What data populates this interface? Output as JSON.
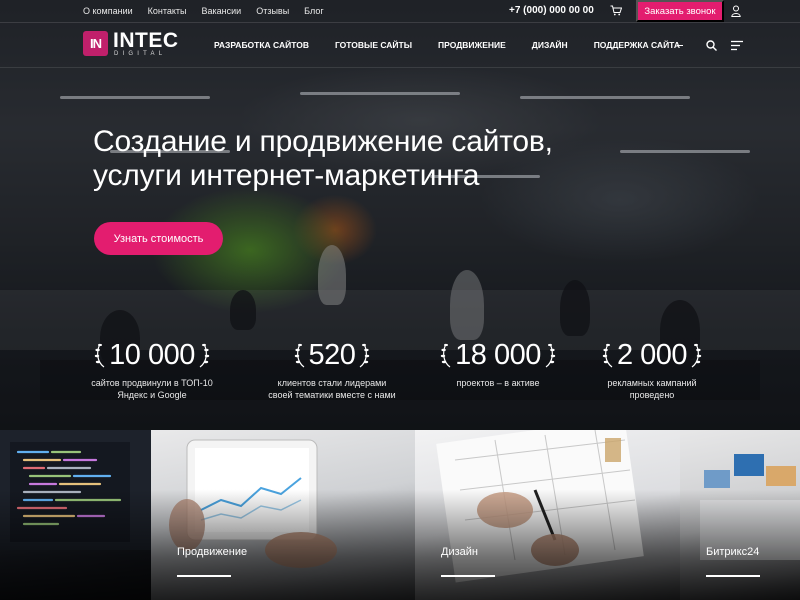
{
  "topbar": {
    "links": [
      "О компании",
      "Контакты",
      "Вакансии",
      "Отзывы",
      "Блог"
    ],
    "phone": "+7 (000) 000 00 00",
    "call_button": "Заказать звонок"
  },
  "header": {
    "logo_mark": "IN",
    "logo_name": "INTEC",
    "logo_sub": "DIGITAL",
    "nav": [
      "Разработка сайтов",
      "Готовые сайты",
      "Продвижение",
      "Дизайн",
      "Поддержка сайта"
    ]
  },
  "hero": {
    "title_line1": "Создание и продвижение сайтов,",
    "title_line2": "услуги интернет-маркетинга",
    "cta": "Узнать стоимость"
  },
  "stats": [
    {
      "value": "10 000",
      "caption_1": "сайтов продвинули в ТОП-10",
      "caption_2": "Яндекс и Google"
    },
    {
      "value": "520",
      "caption_1": "клиентов стали лидерами",
      "caption_2": "своей тематики вместе с нами"
    },
    {
      "value": "18 000",
      "caption_1": "проектов – в активе",
      "caption_2": ""
    },
    {
      "value": "2 000",
      "caption_1": "рекламных кампаний",
      "caption_2": "проведено"
    }
  ],
  "tiles": [
    {
      "label": ""
    },
    {
      "label": "Продвижение"
    },
    {
      "label": "Дизайн"
    },
    {
      "label": "Битрикс24"
    }
  ],
  "colors": {
    "accent": "#e31d6f",
    "logo": "#c0206b"
  },
  "icons": [
    "cart-icon",
    "user-icon",
    "search-icon",
    "menu-icon",
    "laurel-left-icon",
    "laurel-right-icon"
  ]
}
